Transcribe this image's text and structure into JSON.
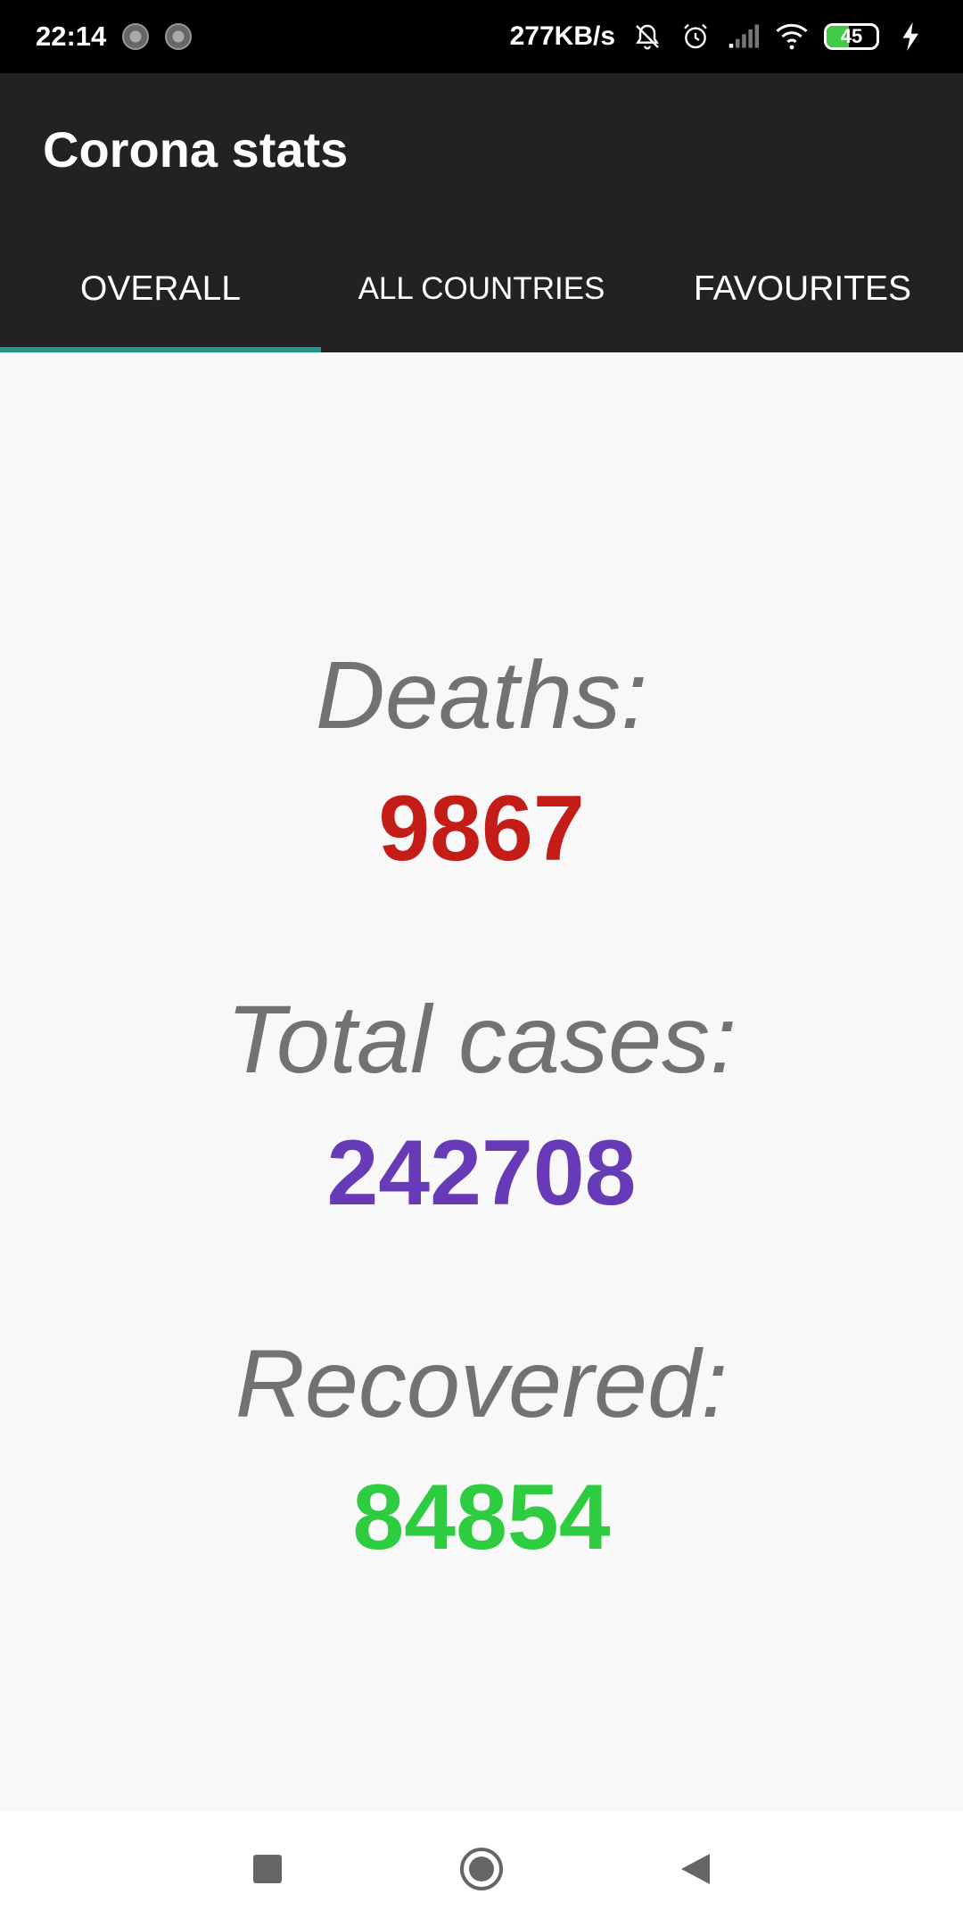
{
  "status_bar": {
    "time": "22:14",
    "network_speed": "277KB/s",
    "battery_level": "45",
    "icons": [
      "sync-icon",
      "sync-icon",
      "bell-off-icon",
      "alarm-icon",
      "signal-icon",
      "wifi-icon",
      "battery-icon",
      "charging-icon"
    ]
  },
  "app_bar": {
    "title": "Corona stats"
  },
  "tabs": [
    {
      "label": "OVERALL",
      "active": true
    },
    {
      "label": "ALL COUNTRIES",
      "active": false
    },
    {
      "label": "FAVOURITES",
      "active": false
    }
  ],
  "stats": {
    "deaths": {
      "label": "Deaths:",
      "value": "9867",
      "color": "#c41c16"
    },
    "total_cases": {
      "label": "Total cases:",
      "value": "242708",
      "color": "#673ab7"
    },
    "recovered": {
      "label": "Recovered:",
      "value": "84854",
      "color": "#2ecc40"
    }
  },
  "colors": {
    "app_bar_bg": "#222222",
    "tab_indicator": "#1e9688",
    "label_gray": "#727272"
  },
  "nav_bar": {
    "buttons": [
      "recents-icon",
      "home-icon",
      "back-icon"
    ]
  }
}
